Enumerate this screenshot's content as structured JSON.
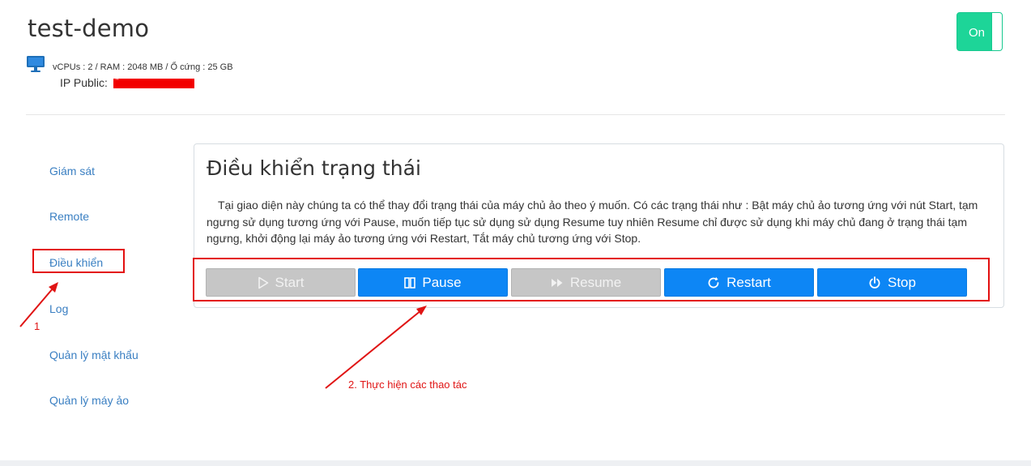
{
  "vm": {
    "name": "test-demo",
    "specs": "vCPUs : 2 / RAM : 2048 MB / Ổ cứng : 25 GB",
    "ip_label": "IP Public:",
    "ip_value_redacted": "\""
  },
  "power_toggle": {
    "label": "On",
    "state": "on"
  },
  "sidebar": {
    "items": [
      {
        "label": "Giám sát"
      },
      {
        "label": "Remote"
      },
      {
        "label": "Điều khiển",
        "highlighted": true
      },
      {
        "label": "Log"
      },
      {
        "label": "Quản lý mật khẩu"
      },
      {
        "label": "Quản lý máy ảo"
      }
    ]
  },
  "panel": {
    "title": "Điều khiển trạng thái",
    "description": "Tại giao diện này chúng ta có thể thay đổi trạng thái của máy chủ ảo theo ý muốn. Có các trạng thái như : Bật máy chủ ảo tương ứng với nút Start, tạm ngưng sử dụng tương ứng với Pause, muốn tiếp tục sử dụng sử dụng Resume tuy nhiên Resume chỉ được sử dụng khi máy chủ đang ở trạng thái tạm ngưng, khởi động lại máy ảo tương ứng với Restart, Tắt máy chủ tương ứng với Stop."
  },
  "buttons": [
    {
      "label": "Start",
      "icon": "play-outline-icon",
      "enabled": false
    },
    {
      "label": "Pause",
      "icon": "pause-icon",
      "enabled": true
    },
    {
      "label": "Resume",
      "icon": "fast-forward-icon",
      "enabled": false
    },
    {
      "label": "Restart",
      "icon": "refresh-icon",
      "enabled": true
    },
    {
      "label": "Stop",
      "icon": "power-icon",
      "enabled": true
    }
  ],
  "annotations": {
    "step1": "1",
    "step2": "2. Thực hiện các thao tác"
  },
  "colors": {
    "accent": "#0d86f5",
    "toggle_on": "#1dd598",
    "link": "#3a7fc2",
    "annotation": "#e01414",
    "disabled_button": "#c6c6c6"
  }
}
